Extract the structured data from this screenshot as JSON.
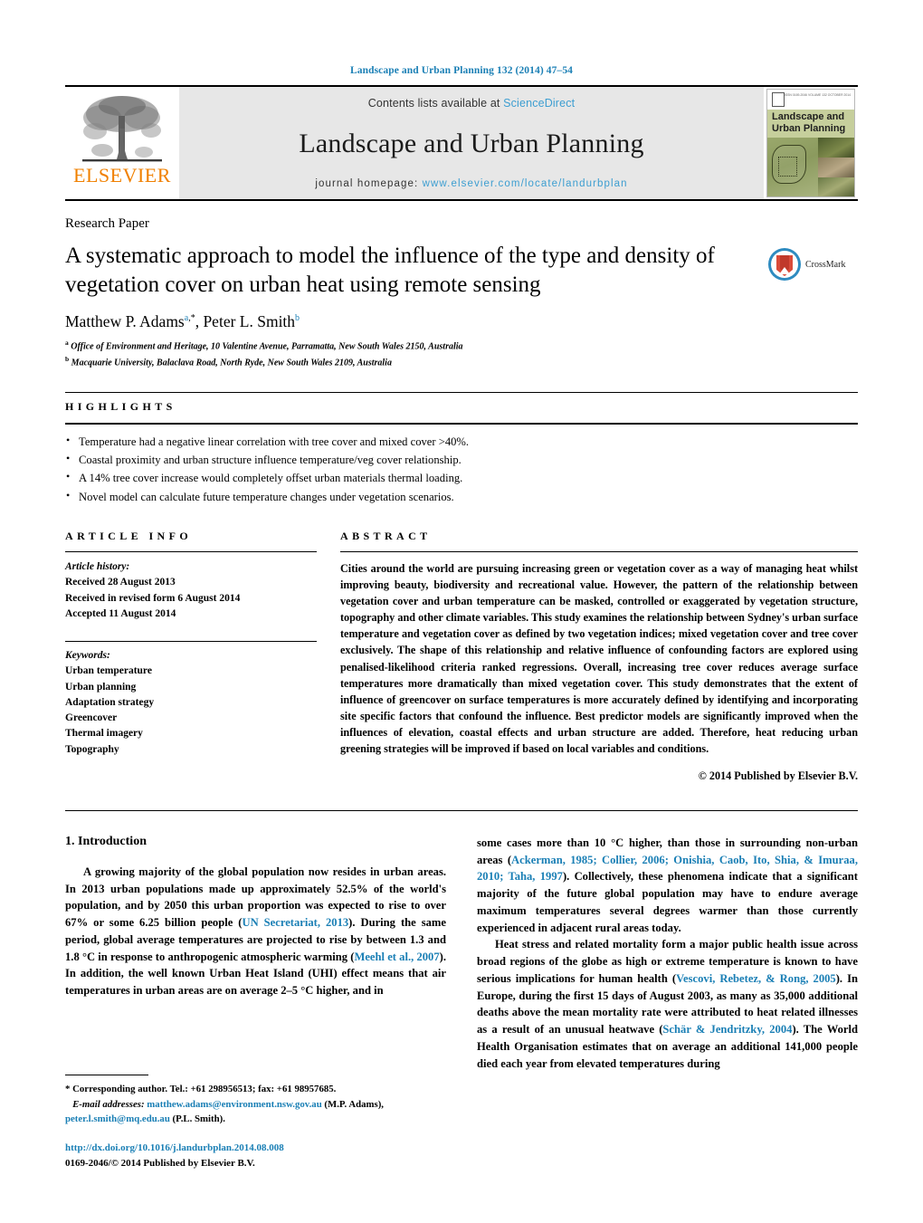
{
  "running_head": "Landscape and Urban Planning 132 (2014) 47–54",
  "masthead": {
    "contents_prefix": "Contents lists available at ",
    "sciencedirect": "ScienceDirect",
    "journal_title": "Landscape and Urban Planning",
    "homepage_prefix": "journal homepage:",
    "homepage_url": "www.elsevier.com/locate/landurbplan",
    "publisher_word": "ELSEVIER",
    "cover": {
      "line1": "Landscape and",
      "line2": "Urban Planning",
      "meta": "ISSN 0169-2046  VOLUME 132\nOCTOBER 2014"
    }
  },
  "article": {
    "type": "Research Paper",
    "title": "A systematic approach to model the influence of the type and density of vegetation cover on urban heat using remote sensing",
    "crossmark_label": "CrossMark",
    "authors_plain": "Matthew P. Adams",
    "author1": "Matthew P. Adams",
    "author1_sup": "a",
    "author1_star": "*",
    "author2": "Peter L. Smith",
    "author2_sup": "b",
    "affiliations": [
      {
        "mark": "a",
        "text": "Office of Environment and Heritage, 10 Valentine Avenue, Parramatta, New South Wales 2150, Australia"
      },
      {
        "mark": "b",
        "text": "Macquarie University, Balaclava Road, North Ryde, New South Wales 2109, Australia"
      }
    ]
  },
  "highlights": {
    "heading": "HIGHLIGHTS",
    "items": [
      "Temperature had a negative linear correlation with tree cover and mixed cover >40%.",
      "Coastal proximity and urban structure influence temperature/veg cover relationship.",
      "A 14% tree cover increase would completely offset urban materials thermal loading.",
      "Novel model can calculate future temperature changes under vegetation scenarios."
    ]
  },
  "article_info": {
    "heading": "ARTICLE INFO",
    "history_label": "Article history:",
    "history": [
      "Received 28 August 2013",
      "Received in revised form 6 August 2014",
      "Accepted 11 August 2014"
    ],
    "keywords_label": "Keywords:",
    "keywords": [
      "Urban temperature",
      "Urban planning",
      "Adaptation strategy",
      "Greencover",
      "Thermal imagery",
      "Topography"
    ]
  },
  "abstract": {
    "heading": "ABSTRACT",
    "text": "Cities around the world are pursuing increasing green or vegetation cover as a way of managing heat whilst improving beauty, biodiversity and recreational value. However, the pattern of the relationship between vegetation cover and urban temperature can be masked, controlled or exaggerated by vegetation structure, topography and other climate variables. This study examines the relationship between Sydney's urban surface temperature and vegetation cover as defined by two vegetation indices; mixed vegetation cover and tree cover exclusively. The shape of this relationship and relative influence of confounding factors are explored using penalised-likelihood criteria ranked regressions. Overall, increasing tree cover reduces average surface temperatures more dramatically than mixed vegetation cover. This study demonstrates that the extent of influence of greencover on surface temperatures is more accurately defined by identifying and incorporating site specific factors that confound the influence. Best predictor models are significantly improved when the influences of elevation, coastal effects and urban structure are added. Therefore, heat reducing urban greening strategies will be improved if based on local variables and conditions.",
    "copyright": "© 2014 Published by Elsevier B.V."
  },
  "body": {
    "section_number_title": "1.  Introduction",
    "left_col": {
      "p1_a": "A growing majority of the global population now resides in urban areas. In 2013 urban populations made up approximately 52.5% of the world's population, and by 2050 this urban proportion was expected to rise to over 67% or some 6.25 billion people (",
      "p1_cite1": "UN Secretariat, 2013",
      "p1_b": "). During the same period, global average temperatures are projected to rise by between 1.3 and 1.8 °C in response to anthropogenic atmospheric warming (",
      "p1_cite2": "Meehl et al., 2007",
      "p1_c": "). In addition, the well known Urban Heat Island (UHI) effect means that air temperatures in urban areas are on average 2–5 °C higher, and in"
    },
    "right_col": {
      "p1_d": "some cases more than 10 °C higher, than those in surrounding non-urban areas (",
      "p1_cite3": "Ackerman, 1985; Collier, 2006; Onishia, Caob, Ito, Shia, & Imuraa, 2010; Taha, 1997",
      "p1_e": "). Collectively, these phenomena indicate that a significant majority of the future global population may have to endure average maximum temperatures several degrees warmer than those currently experienced in adjacent rural areas today.",
      "p2_a": "Heat stress and related mortality form a major public health issue across broad regions of the globe as high or extreme temperature is known to have serious implications for human health (",
      "p2_cite1": "Vescovi, Rebetez, & Rong, 2005",
      "p2_b": "). In Europe, during the first 15 days of August 2003, as many as 35,000 additional deaths above the mean mortality rate were attributed to heat related illnesses as a result of an unusual heatwave (",
      "p2_cite2": "Schär & Jendritzky, 2004",
      "p2_c": "). The World Health Organisation estimates that on average an additional 141,000 people died each year from elevated temperatures during"
    }
  },
  "footnotes": {
    "corresponding": "* Corresponding author. Tel.: +61 298956513; fax: +61 98957685.",
    "email_label": "E-mail addresses:",
    "email1": "matthew.adams@environment.nsw.gov.au",
    "email1_owner": "(M.P. Adams),",
    "email2": "peter.l.smith@mq.edu.au",
    "email2_owner": "(P.L. Smith).",
    "doi": "http://dx.doi.org/10.1016/j.landurbplan.2014.08.008",
    "issn": "0169-2046/© 2014 Published by Elsevier B.V."
  },
  "colors": {
    "link": "#1a7fb5",
    "sciencedirect": "#3d9ed1",
    "elsevier_orange": "#f08000",
    "masthead_bg": "#e7e7e7"
  }
}
